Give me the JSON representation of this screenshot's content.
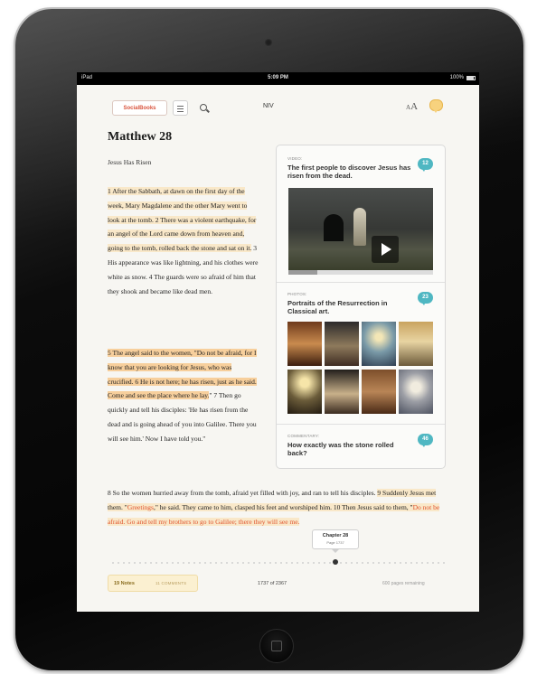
{
  "status_bar": {
    "carrier": "iPad",
    "time": "5:09 PM",
    "battery": "100%"
  },
  "toolbar": {
    "logo_label": "SocialBooks",
    "version": "NIV",
    "font_size_icon": "AA"
  },
  "chapter": {
    "title": "Matthew 28",
    "heading": "Jesus Has Risen",
    "passage_1": {
      "highlighted": "1 After the Sabbath, at dawn on the first day of the week, Mary Magdalene and the other Mary went to look at the tomb. 2 There was a violent earthquake, for an angel of the Lord came down from heaven and, going to the tomb, rolled back the stone and sat on it.",
      "plain": " 3 His appearance was like lightning, and his clothes were white as snow. 4 The guards were so afraid of him that they shook and became like dead men."
    },
    "passage_2": {
      "highlighted": "5 The angel said to the women, \"Do not be afraid, for I know that you are looking for Jesus, who was crucified. 6 He is not here; he has risen, just as he said. Come and see the place where he lay.",
      "plain": "\" 7 Then go quickly and tell his disciples: 'He has risen from the dead and is going ahead of you into Galilee. There you will see him.' Now I have told you.\""
    },
    "passage_3": {
      "part_a": "8 So the women hurried away from the tomb, afraid yet filled with joy, and ran to tell his disciples. ",
      "part_b": "9 Suddenly Jesus met them. \"",
      "part_c": "Greetings",
      "part_d": ",\" he said. They came to him, clasped his feet and worshiped him. 10 Then Jesus said to them, \"",
      "part_e": "Do not be afraid. Go and tell my brothers to go to Galilee; there they will see me."
    }
  },
  "sidebar": {
    "video": {
      "kind": "VIDEO:",
      "title": "The first people to discover Jesus has risen from the dead.",
      "count": "12"
    },
    "photos": {
      "kind": "PHOTOS:",
      "title": "Portraits of the Resurrection in Classical art.",
      "count": "23"
    },
    "commentary": {
      "kind": "COMMENTARY:",
      "title": "How exactly was the stone rolled back?",
      "count": "46"
    }
  },
  "scrubber": {
    "chapter": "Chapter 28",
    "page": "Page 1737",
    "progress": 0.69
  },
  "bottom_bar": {
    "notes": "19 Notes",
    "comments": "11 COMMENTS",
    "page_count": "1737 of 2367",
    "pages_remaining": "600 pages remaining"
  },
  "colors": {
    "highlight_soft": "#f9e8c9",
    "highlight_strong": "#f7cf9c",
    "red_letters": "#e0542f",
    "badge": "#4fb7c2",
    "brand_red": "#d9533c"
  }
}
